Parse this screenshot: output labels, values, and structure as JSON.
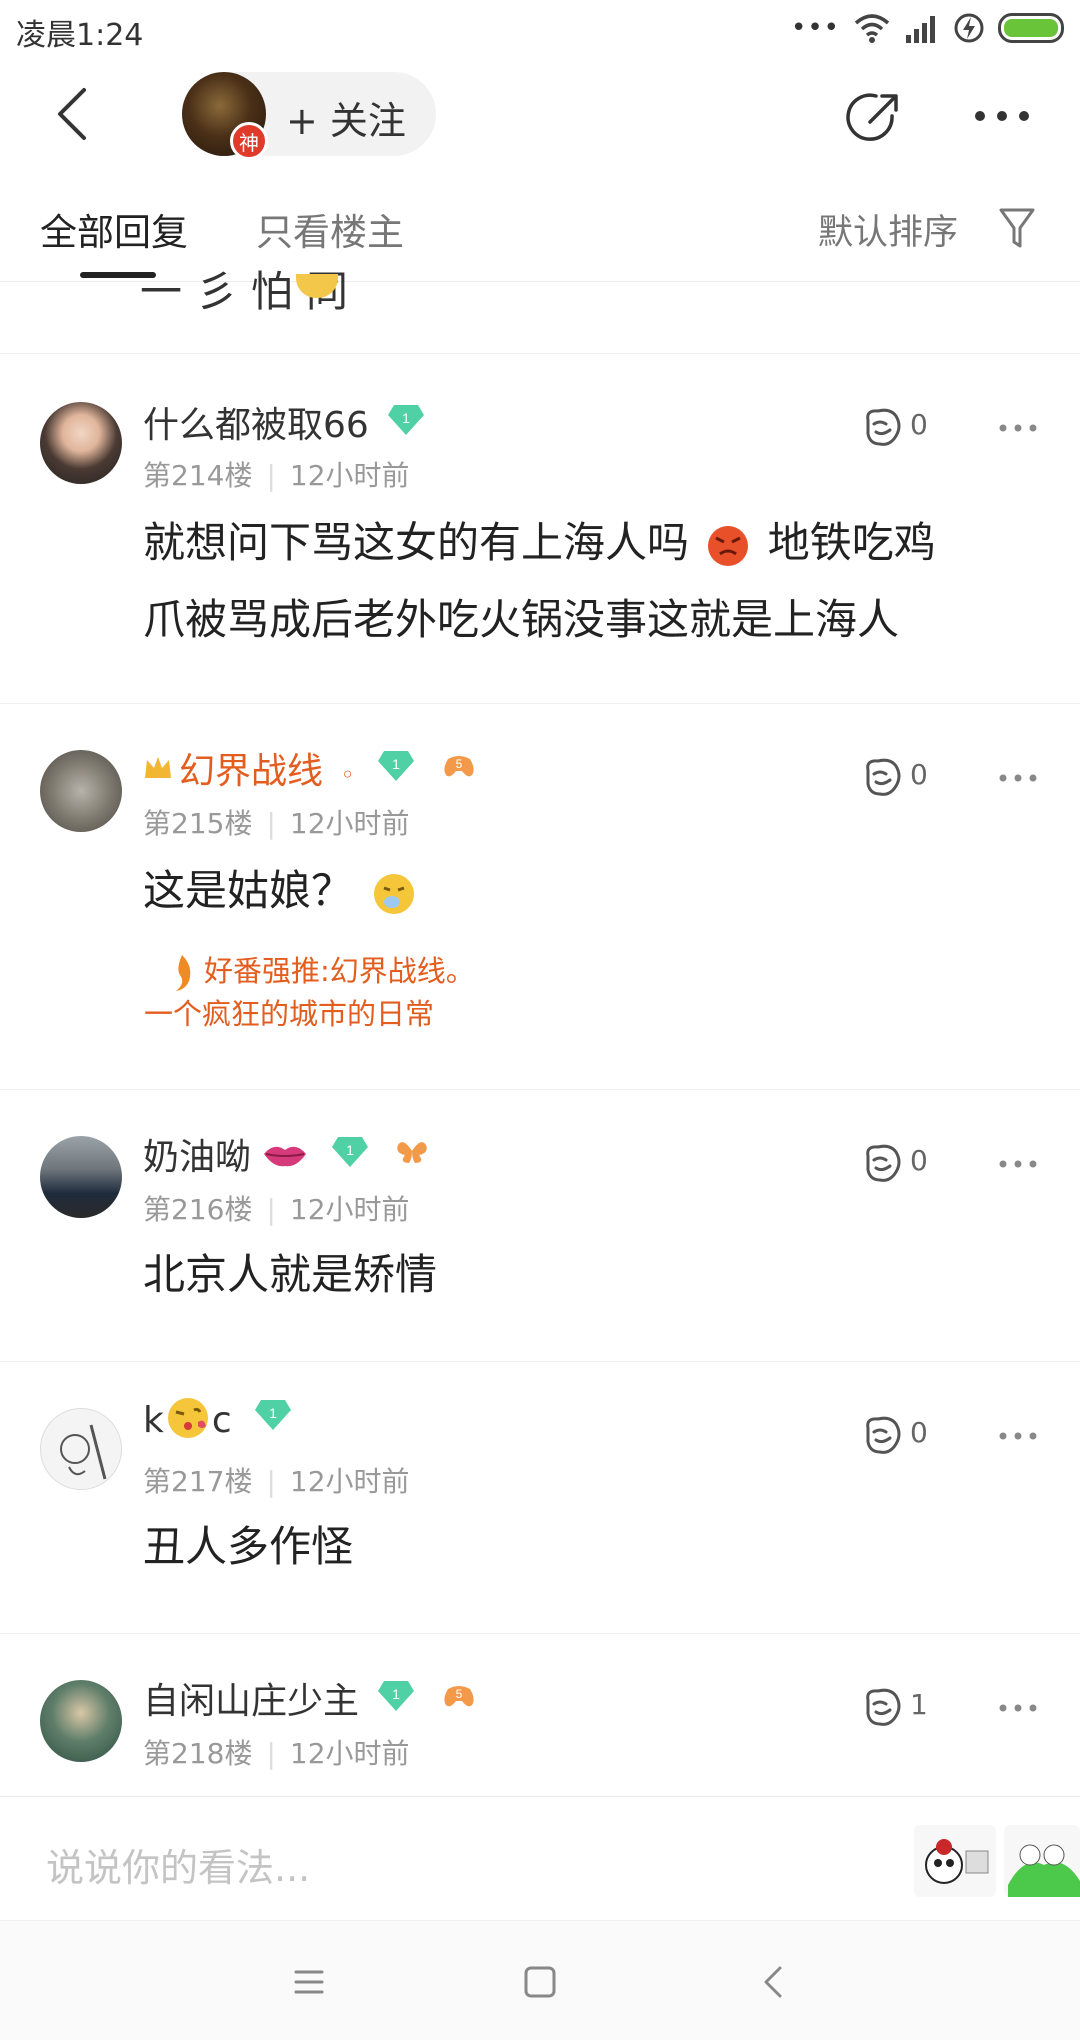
{
  "status_bar": {
    "time": "凌晨1:24",
    "dots": "•••"
  },
  "header": {
    "follow_label": "+ 关注",
    "god_badge": "神"
  },
  "tabs": {
    "all_replies": "全部回复",
    "only_op": "只看楼主",
    "sort": "默认排序"
  },
  "partial_comment": {
    "text_fragment": "一 彡 怕 同"
  },
  "comments": [
    {
      "username": "什么都被取66",
      "level": "1",
      "floor": "第214楼",
      "time": "12小时前",
      "likes": "0",
      "text_line1": "就想问下骂这女的有上海人吗",
      "text_line1b": "地铁吃鸡",
      "text_line2": "爪被骂成后老外吃火锅没事这就是上海人"
    },
    {
      "username": "幻界战线",
      "username_suffix": "◦",
      "level": "1",
      "badge2": "5",
      "floor": "第215楼",
      "time": "12小时前",
      "likes": "0",
      "text": "这是姑娘？",
      "promo_line1": "好番强推:幻界战线。",
      "promo_line2": "一个疯狂的城市的日常"
    },
    {
      "username": "奶油呦",
      "level": "1",
      "floor": "第216楼",
      "time": "12小时前",
      "likes": "0",
      "text": "北京人就是矫情"
    },
    {
      "username_a": "k",
      "username_b": "c",
      "level": "1",
      "floor": "第217楼",
      "time": "12小时前",
      "likes": "0",
      "text": "丑人多作怪"
    },
    {
      "username": "自闲山庄少主",
      "level": "1",
      "badge2": "5",
      "floor": "第218楼",
      "time": "12小时前",
      "likes": "1"
    }
  ],
  "input": {
    "placeholder": "说说你的看法..."
  },
  "colors": {
    "accent_orange": "#e35d1e",
    "diamond_green": "#4fd1a5",
    "text_gray": "#999999"
  },
  "icons": [
    "back-arrow-icon",
    "share-icon",
    "more-icon",
    "filter-icon",
    "like-icon",
    "menu-icon",
    "home-icon",
    "nav-back-icon"
  ]
}
